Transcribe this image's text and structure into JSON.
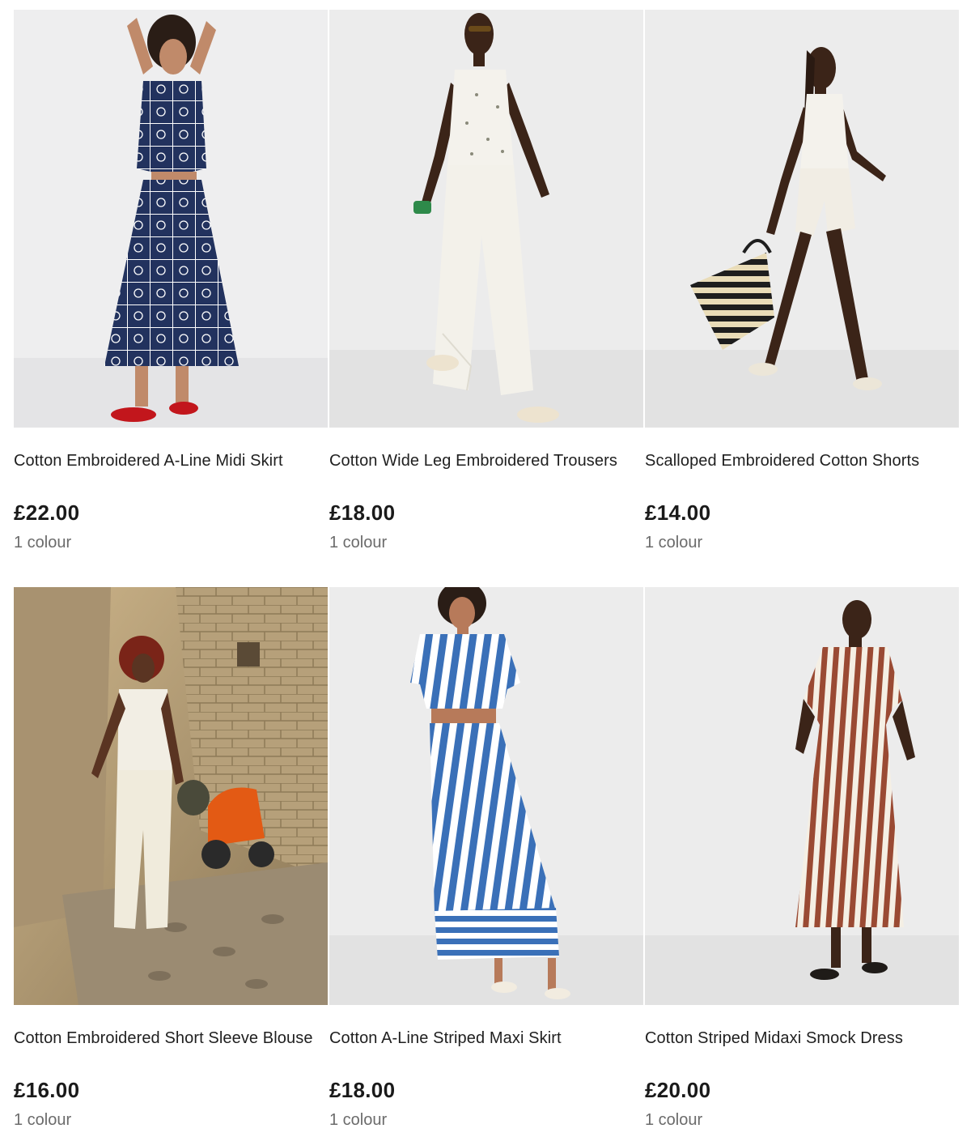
{
  "products": [
    {
      "title": "Cotton Embroidered A-Line Midi Skirt",
      "price": "£22.00",
      "colours": "1 colour",
      "colors": {
        "background": "#eeeeef",
        "top": "#1f2f5a",
        "bottom": "#22325e",
        "pattern": "#ffffff",
        "shoes": "#c2161c",
        "skin": "#c08a6a"
      }
    },
    {
      "title": "Cotton Wide Leg Embroidered Trousers",
      "price": "£18.00",
      "colours": "1 colour",
      "colors": {
        "background": "#ececec",
        "top": "#f4f2ec",
        "bottom": "#f3f1ea",
        "skin": "#3b2418"
      }
    },
    {
      "title": "Scalloped Embroidered Cotton Shorts",
      "price": "£14.00",
      "colours": "1 colour",
      "colors": {
        "background": "#ececec",
        "top": "#f4f2ec",
        "bottom": "#f1ede4",
        "skin": "#3b2418",
        "bag": "#1e1e1e"
      }
    },
    {
      "title": "Cotton Embroidered Short Sleeve Blouse",
      "price": "£16.00",
      "colours": "1 colour",
      "colors": {
        "background": "#b6a07a",
        "top": "#f2eee4",
        "bottom": "#f0ebdc",
        "skin": "#5a3422",
        "scooter": "#e35a14"
      }
    },
    {
      "title": "Cotton A-Line Striped Maxi Skirt",
      "price": "£18.00",
      "colours": "1 colour",
      "colors": {
        "background": "#ececec",
        "top": "#3a70b8",
        "bottom": "#3a70b8",
        "skin": "#b77a5a"
      }
    },
    {
      "title": "Cotton Striped Midaxi Smock Dress",
      "price": "£20.00",
      "colours": "1 colour",
      "colors": {
        "background": "#ececec",
        "top": "#9a4a33",
        "bottom": "#9a4a33",
        "skin": "#3b2418"
      }
    }
  ]
}
